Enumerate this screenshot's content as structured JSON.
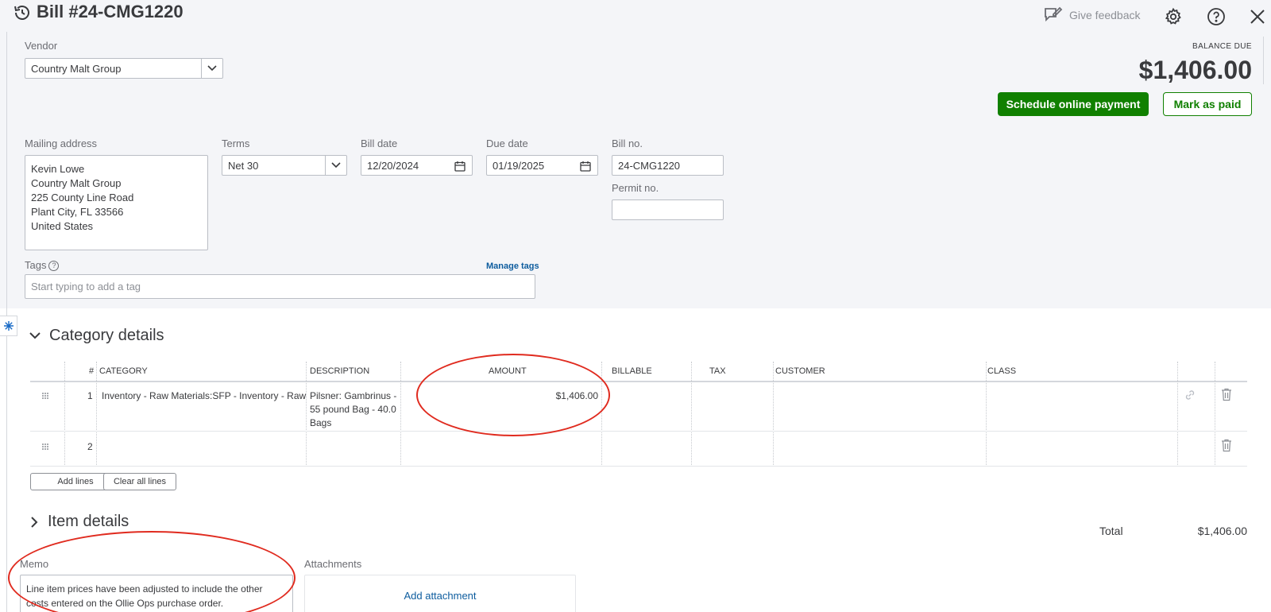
{
  "header": {
    "title": "Bill #24-CMG1220",
    "give_feedback": "Give feedback"
  },
  "vendor": {
    "label": "Vendor",
    "value": "Country Malt Group"
  },
  "balance": {
    "label": "BALANCE DUE",
    "amount": "$1,406.00"
  },
  "actions": {
    "schedule": "Schedule online payment",
    "mark_paid": "Mark as paid"
  },
  "mailing": {
    "label": "Mailing address",
    "lines": [
      "Kevin Lowe",
      "Country Malt Group",
      "225 County Line Road",
      "Plant City, FL  33566",
      "United States"
    ]
  },
  "terms": {
    "label": "Terms",
    "value": "Net 30"
  },
  "bill_date": {
    "label": "Bill date",
    "value": "12/20/2024"
  },
  "due_date": {
    "label": "Due date",
    "value": "01/19/2025"
  },
  "bill_no": {
    "label": "Bill no.",
    "value": "24-CMG1220"
  },
  "permit_no": {
    "label": "Permit no.",
    "value": ""
  },
  "tags": {
    "label": "Tags",
    "manage": "Manage tags",
    "placeholder": "Start typing to add a tag"
  },
  "category_details": {
    "title": "Category details",
    "columns": [
      "#",
      "CATEGORY",
      "DESCRIPTION",
      "AMOUNT",
      "BILLABLE",
      "TAX",
      "CUSTOMER",
      "CLASS"
    ],
    "rows": [
      {
        "num": "1",
        "category": "Inventory - Raw Materials:SFP - Inventory - Raw M",
        "description": "Pilsner: Gambrinus - 55 pound Bag - 40.0 Bags",
        "amount": "$1,406.00"
      },
      {
        "num": "2",
        "category": "",
        "description": "",
        "amount": ""
      }
    ],
    "add_lines": "Add lines",
    "clear_lines": "Clear all lines"
  },
  "item_details": {
    "title": "Item details"
  },
  "total": {
    "label": "Total",
    "value": "$1,406.00"
  },
  "memo": {
    "label": "Memo",
    "value": "Line item prices have been adjusted to include the other costs entered on the Ollie Ops purchase order."
  },
  "attachments": {
    "label": "Attachments",
    "add": "Add attachment"
  },
  "colors": {
    "primary_green": "#108000",
    "link_blue": "#0d5c9e",
    "annotation_red": "#e02b1f"
  }
}
